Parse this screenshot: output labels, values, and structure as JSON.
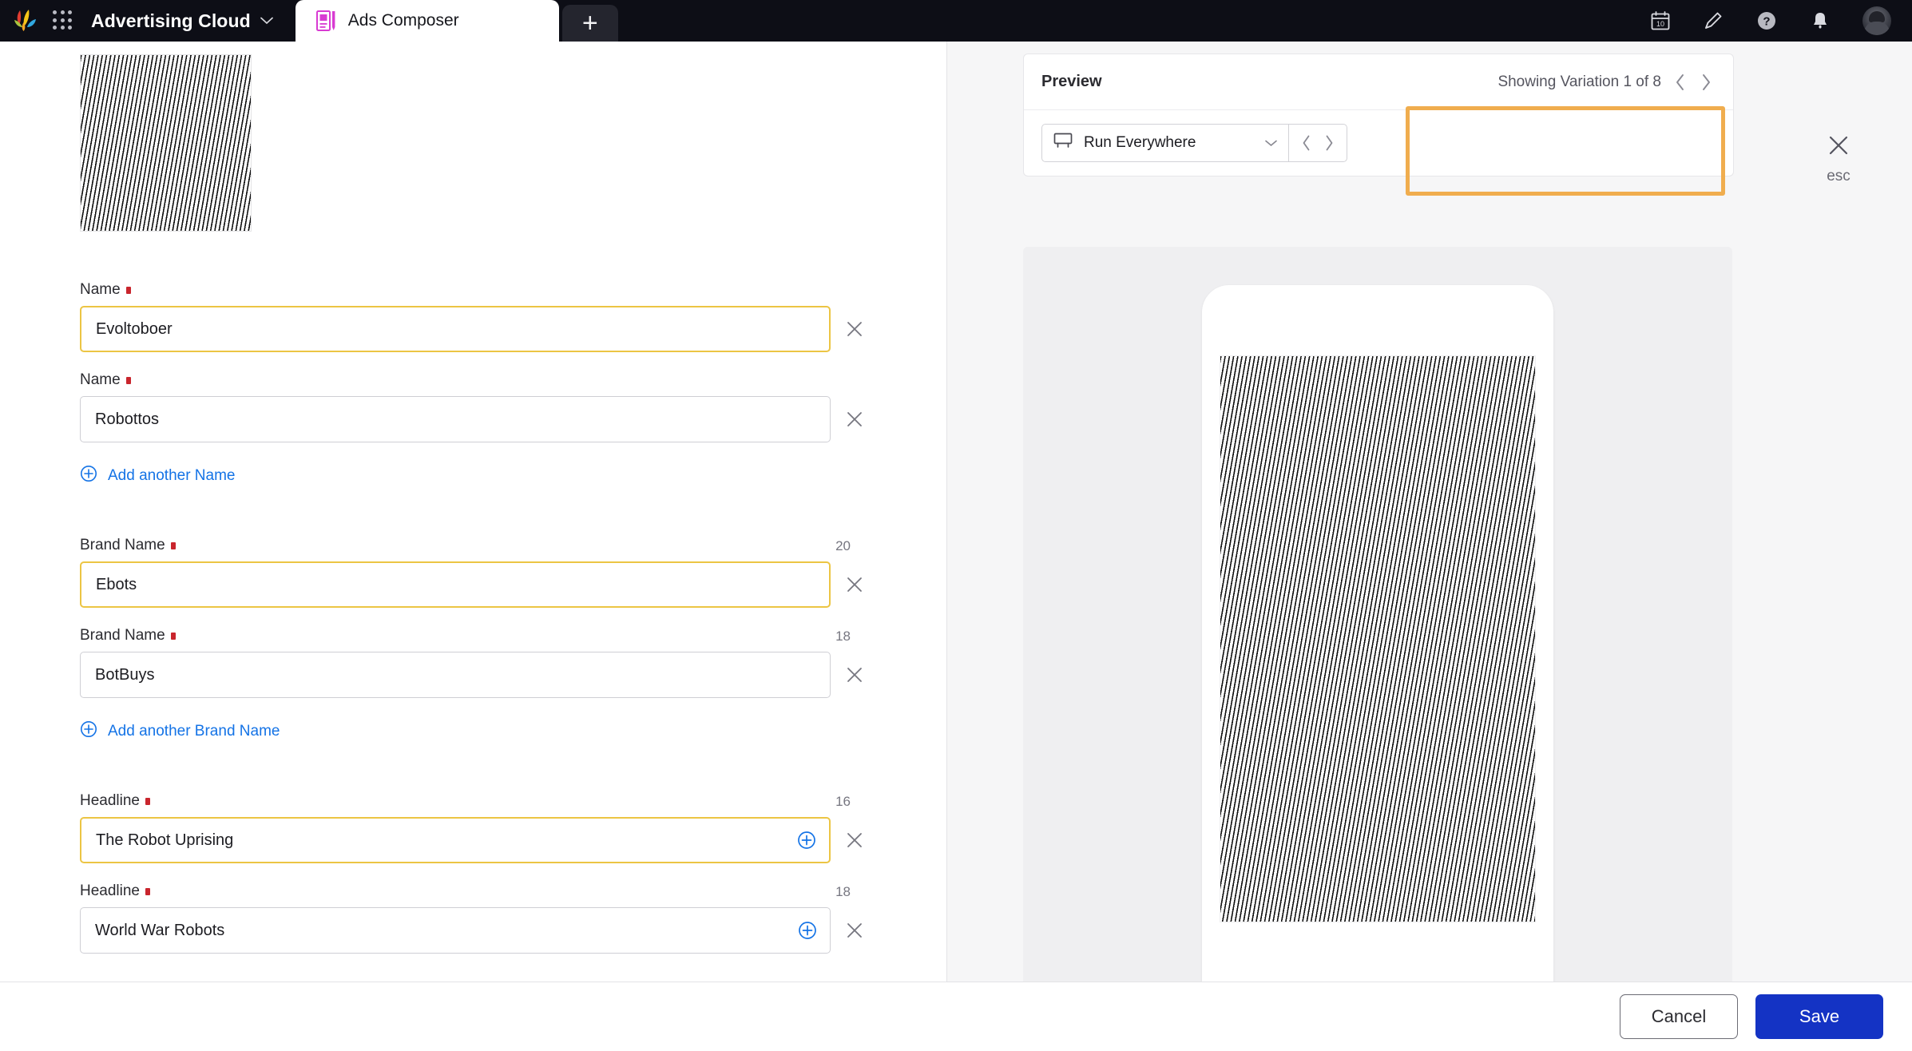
{
  "topbar": {
    "logo_name": "adobe-splash-logo",
    "app_grid_icon": "app-grid-icon",
    "cloud_name": "Advertising Cloud",
    "cloud_chevron": "⌄",
    "tabs": [
      {
        "label": "Ads Composer",
        "icon": "ads-composer-icon",
        "active": true
      }
    ],
    "new_tab_glyph": "+",
    "icons": [
      {
        "name": "calendar-icon",
        "label": "10"
      },
      {
        "name": "pencil-icon"
      },
      {
        "name": "help-icon",
        "label": "?"
      },
      {
        "name": "bell-icon"
      },
      {
        "name": "avatar"
      }
    ]
  },
  "form": {
    "thumbnail_alt": "halftone-line-art-preview",
    "groups": [
      {
        "group_name": "name-group",
        "add_link": "Add another Name",
        "fields": [
          {
            "label": "Name",
            "required": true,
            "value": "Evoltoboer",
            "counter": "",
            "focused": true,
            "has_plus": false
          },
          {
            "label": "Name",
            "required": true,
            "value": "Robottos",
            "counter": "",
            "focused": false,
            "has_plus": false
          }
        ]
      },
      {
        "group_name": "brand-name-group",
        "add_link": "Add another Brand Name",
        "fields": [
          {
            "label": "Brand Name",
            "required": true,
            "value": "Ebots",
            "counter": "20",
            "focused": true,
            "has_plus": false
          },
          {
            "label": "Brand Name",
            "required": true,
            "value": "BotBuys",
            "counter": "18",
            "focused": false,
            "has_plus": false
          }
        ]
      },
      {
        "group_name": "headline-group",
        "add_link": "",
        "fields": [
          {
            "label": "Headline",
            "required": true,
            "value": "The Robot Uprising",
            "counter": "16",
            "focused": true,
            "has_plus": true
          },
          {
            "label": "Headline",
            "required": true,
            "value": "World War Robots",
            "counter": "18",
            "focused": false,
            "has_plus": true
          }
        ]
      }
    ]
  },
  "preview": {
    "title": "Preview",
    "variation_text": "Showing Variation 1 of 8",
    "prev_glyph": "‹",
    "next_glyph": "›",
    "placement_value": "Run Everywhere",
    "placement_icon": "billboard-icon",
    "placement_chevron": "⌄",
    "creative_alt": "halftone-line-art-creative"
  },
  "esc": {
    "label": "esc",
    "icon": "close-icon"
  },
  "footer": {
    "cancel_label": "Cancel",
    "save_label": "Save"
  },
  "colors": {
    "accent_blue": "#1433c4",
    "link_blue": "#1473e6",
    "focus_yellow": "#ecc544",
    "highlight_orange": "#f0ad4e",
    "required_red": "#c9252d",
    "topbar_bg": "#0d0e16",
    "tab_accent_magenta": "#d83bd2"
  }
}
